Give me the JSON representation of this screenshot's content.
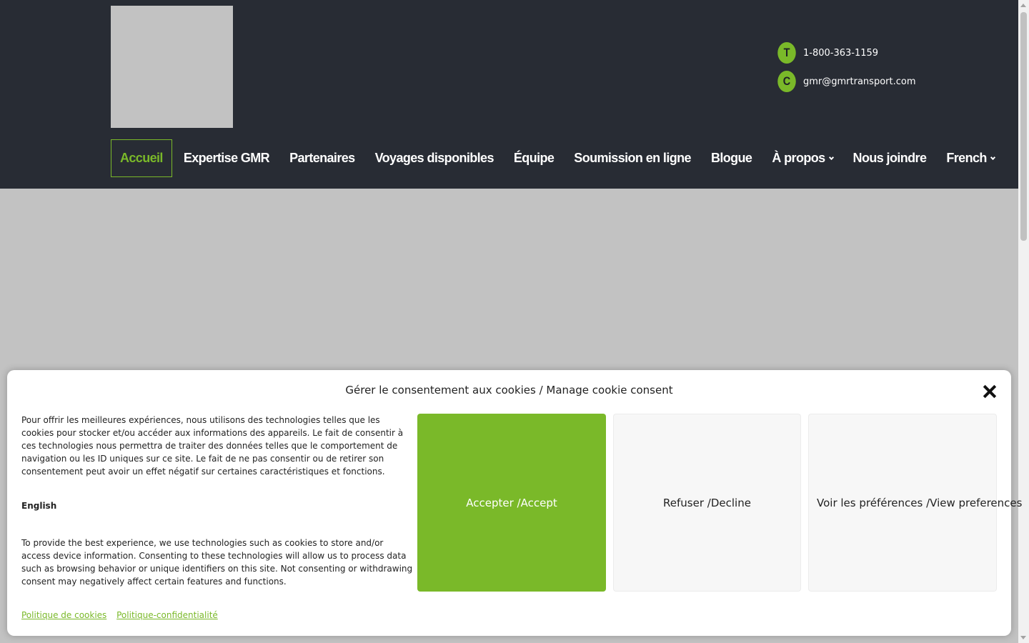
{
  "header": {
    "contact": {
      "phone_badge": "T",
      "phone": "1-800-363-1159",
      "email_badge": "C",
      "email": "gmr@gmrtransport.com"
    },
    "nav": [
      {
        "label": "Accueil",
        "active": true
      },
      {
        "label": "Expertise GMR"
      },
      {
        "label": "Partenaires"
      },
      {
        "label": "Voyages disponibles"
      },
      {
        "label": "Équipe"
      },
      {
        "label": "Soumission en ligne"
      },
      {
        "label": "Blogue"
      },
      {
        "label": "À propos",
        "dropdown": true
      },
      {
        "label": "Nous joindre"
      },
      {
        "label": "French",
        "dropdown": true
      }
    ]
  },
  "cookie_modal": {
    "title": "Gérer le consentement aux cookies / Manage cookie consent",
    "text_fr": "Pour offrir les meilleures expériences, nous utilisons des technologies telles que les cookies pour stocker et/ou accéder aux informations des appareils. Le fait de consentir à ces technologies nous permettra de traiter des données telles que le comportement de navigation ou les ID uniques sur ce site. Le fait de ne pas consentir ou de retirer son consentement peut avoir un effet négatif sur certaines caractéristiques et fonctions.",
    "english_heading": "English",
    "text_en": "To provide the best experience, we use technologies such as cookies to store and/or access device information. Consenting to these technologies will allow us to process data such as browsing behavior or unique identifiers on this site. Not consenting or withdrawing consent may negatively affect certain features and functions.",
    "accept_label": "Accepter /Accept",
    "decline_label": "Refuser /Decline",
    "preferences_label": "Voir les préférences /View preferences",
    "links": [
      "Politique de cookies",
      "Politique-confidentialité"
    ]
  },
  "colors": {
    "header_bg": "#282c34",
    "accent": "#7ab929",
    "placeholder": "#c2c2c2"
  }
}
